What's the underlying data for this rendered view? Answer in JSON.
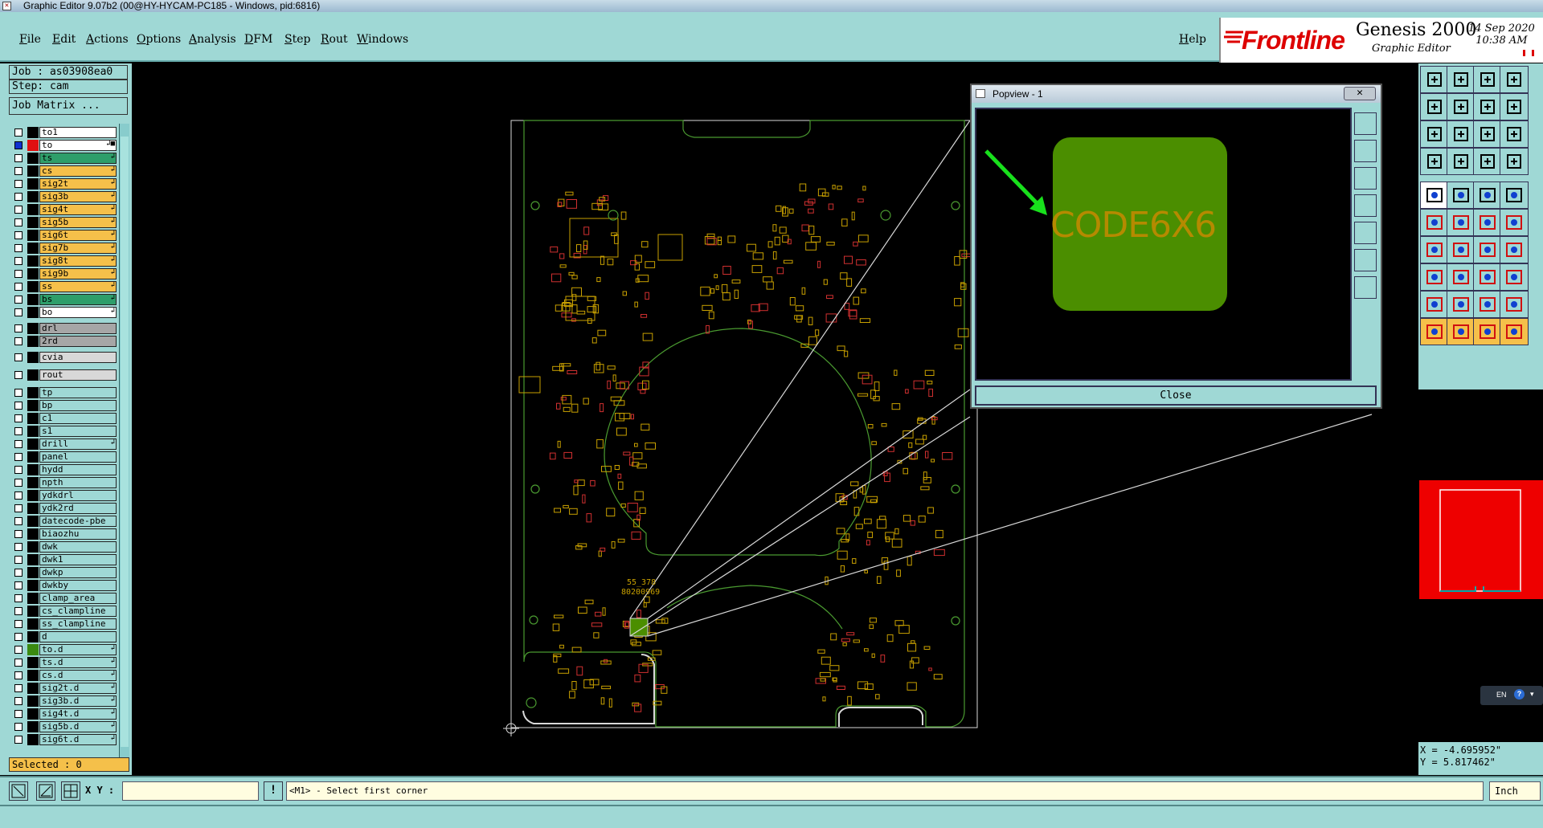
{
  "window": {
    "title": "Graphic Editor 9.07b2 (00@HY-HYCAM-PC185 - Windows, pid:6816)"
  },
  "menu": {
    "items": [
      "File",
      "Edit",
      "Actions",
      "Options",
      "Analysis",
      "DFM",
      "Step",
      "Rout",
      "Windows"
    ],
    "help": "Help"
  },
  "logo": {
    "brand_red": "Frontline",
    "product": "Genesis 2000",
    "subtitle": "Graphic Editor",
    "date": "14 Sep 2020",
    "time": "10:38 AM"
  },
  "job": {
    "job_label": "Job : as03908ea0",
    "step_label": "Step: cam",
    "matrix_button": "Job Matrix ..."
  },
  "layers": [
    {
      "name": "to1",
      "color": "#ffffff",
      "swatch": "#000000",
      "arrow": ""
    },
    {
      "name": "to",
      "color": "#ffffff",
      "swatch": "#e01010",
      "arrow": "↲■",
      "active": true
    },
    {
      "name": "ts",
      "color": "#2e9e6a",
      "swatch": "#000000",
      "arrow": "↲"
    },
    {
      "name": "cs",
      "color": "#f5c04a",
      "swatch": "#000000",
      "arrow": "↲"
    },
    {
      "name": "sig2t",
      "color": "#f5c04a",
      "swatch": "#000000",
      "arrow": "↲"
    },
    {
      "name": "sig3b",
      "color": "#f5c04a",
      "swatch": "#000000",
      "arrow": "↲"
    },
    {
      "name": "sig4t",
      "color": "#f5c04a",
      "swatch": "#000000",
      "arrow": "↲"
    },
    {
      "name": "sig5b",
      "color": "#f5c04a",
      "swatch": "#000000",
      "arrow": "↲"
    },
    {
      "name": "sig6t",
      "color": "#f5c04a",
      "swatch": "#000000",
      "arrow": "↲"
    },
    {
      "name": "sig7b",
      "color": "#f5c04a",
      "swatch": "#000000",
      "arrow": "↲"
    },
    {
      "name": "sig8t",
      "color": "#f5c04a",
      "swatch": "#000000",
      "arrow": "↲"
    },
    {
      "name": "sig9b",
      "color": "#f5c04a",
      "swatch": "#000000",
      "arrow": "↲"
    },
    {
      "name": "ss",
      "color": "#f5c04a",
      "swatch": "#000000",
      "arrow": "↲"
    },
    {
      "name": "bs",
      "color": "#2e9e6a",
      "swatch": "#000000",
      "arrow": "↲"
    },
    {
      "name": "bo",
      "color": "#ffffff",
      "swatch": "#000000",
      "arrow": "↲"
    },
    {
      "name": "drl",
      "color": "#a6a6a6",
      "swatch": "#000000",
      "arrow": "",
      "gap": true
    },
    {
      "name": "2rd",
      "color": "#a6a6a6",
      "swatch": "#000000",
      "arrow": ""
    },
    {
      "name": "cvia",
      "color": "#d8d8d8",
      "swatch": "#000000",
      "arrow": "",
      "gap": true
    },
    {
      "name": "rout",
      "color": "#d8d8d8",
      "swatch": "#000000",
      "arrow": "",
      "gap": true
    },
    {
      "name": "tp",
      "color": "#9fd8d5",
      "swatch": "#000000",
      "arrow": "",
      "gap": true
    },
    {
      "name": "bp",
      "color": "#9fd8d5",
      "swatch": "#000000",
      "arrow": ""
    },
    {
      "name": "c1",
      "color": "#9fd8d5",
      "swatch": "#000000",
      "arrow": ""
    },
    {
      "name": "s1",
      "color": "#9fd8d5",
      "swatch": "#000000",
      "arrow": ""
    },
    {
      "name": "drill",
      "color": "#9fd8d5",
      "swatch": "#000000",
      "arrow": "↲"
    },
    {
      "name": "panel",
      "color": "#9fd8d5",
      "swatch": "#000000",
      "arrow": ""
    },
    {
      "name": "hydd",
      "color": "#9fd8d5",
      "swatch": "#000000",
      "arrow": ""
    },
    {
      "name": "npth",
      "color": "#9fd8d5",
      "swatch": "#000000",
      "arrow": ""
    },
    {
      "name": "ydkdrl",
      "color": "#9fd8d5",
      "swatch": "#000000",
      "arrow": ""
    },
    {
      "name": "ydk2rd",
      "color": "#9fd8d5",
      "swatch": "#000000",
      "arrow": ""
    },
    {
      "name": "datecode-pbe",
      "color": "#9fd8d5",
      "swatch": "#000000",
      "arrow": ""
    },
    {
      "name": "biaozhu",
      "color": "#9fd8d5",
      "swatch": "#000000",
      "arrow": ""
    },
    {
      "name": "dwk",
      "color": "#9fd8d5",
      "swatch": "#000000",
      "arrow": ""
    },
    {
      "name": "dwk1",
      "color": "#9fd8d5",
      "swatch": "#000000",
      "arrow": ""
    },
    {
      "name": "dwkp",
      "color": "#9fd8d5",
      "swatch": "#000000",
      "arrow": ""
    },
    {
      "name": "dwkby",
      "color": "#9fd8d5",
      "swatch": "#000000",
      "arrow": ""
    },
    {
      "name": "clamp_area",
      "color": "#9fd8d5",
      "swatch": "#000000",
      "arrow": ""
    },
    {
      "name": "cs_clampline",
      "color": "#9fd8d5",
      "swatch": "#000000",
      "arrow": ""
    },
    {
      "name": "ss_clampline",
      "color": "#9fd8d5",
      "swatch": "#000000",
      "arrow": ""
    },
    {
      "name": "d",
      "color": "#9fd8d5",
      "swatch": "#000000",
      "arrow": ""
    },
    {
      "name": "to.d",
      "color": "#9fd8d5",
      "swatch": "#3a8a10",
      "arrow": "↲"
    },
    {
      "name": "ts.d",
      "color": "#9fd8d5",
      "swatch": "#000000",
      "arrow": "↲"
    },
    {
      "name": "cs.d",
      "color": "#9fd8d5",
      "swatch": "#000000",
      "arrow": "↲"
    },
    {
      "name": "sig2t.d",
      "color": "#9fd8d5",
      "swatch": "#000000",
      "arrow": "↲"
    },
    {
      "name": "sig3b.d",
      "color": "#9fd8d5",
      "swatch": "#000000",
      "arrow": "↲"
    },
    {
      "name": "sig4t.d",
      "color": "#9fd8d5",
      "swatch": "#000000",
      "arrow": "↲"
    },
    {
      "name": "sig5b.d",
      "color": "#9fd8d5",
      "swatch": "#000000",
      "arrow": "↲"
    },
    {
      "name": "sig6t.d",
      "color": "#9fd8d5",
      "swatch": "#000000",
      "arrow": "↲"
    }
  ],
  "selected_label": "Selected : 0",
  "popview": {
    "title": "Popview - 1",
    "close_x": "✕",
    "pad_text": "CODE6X6",
    "close_button": "Close"
  },
  "board": {
    "text1": "55_378",
    "text2": "80200969"
  },
  "coords": {
    "x": "X = -4.695952\"",
    "y": "Y = 5.817462\""
  },
  "lang": {
    "code": "EN"
  },
  "command": {
    "xy_label": "X Y :",
    "xy_value": "",
    "message": "<M1> - Select first corner",
    "unit": "Inch"
  },
  "colors": {
    "panel": "#9fd8d5",
    "signal": "#f5c04a",
    "pad": "#4b8e00",
    "overview": "#ee0000"
  }
}
